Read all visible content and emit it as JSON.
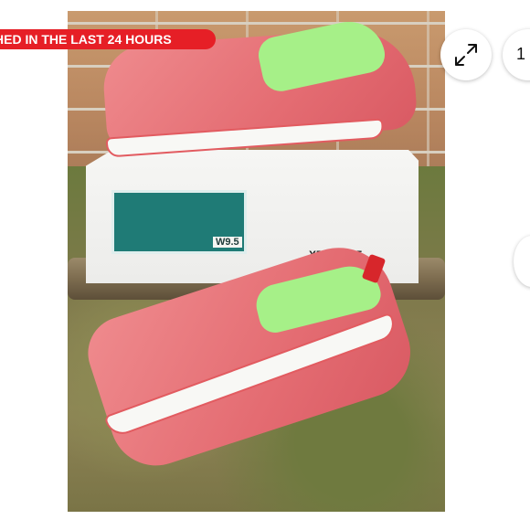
{
  "banner": {
    "text": "HED IN THE LAST 24 HOURS",
    "color": "#e61f26"
  },
  "photo": {
    "box_brand": "XTRATUF",
    "label_size": "W9.5"
  },
  "controls": {
    "expand_icon": "expand-arrows-icon",
    "image_counter": "1"
  }
}
